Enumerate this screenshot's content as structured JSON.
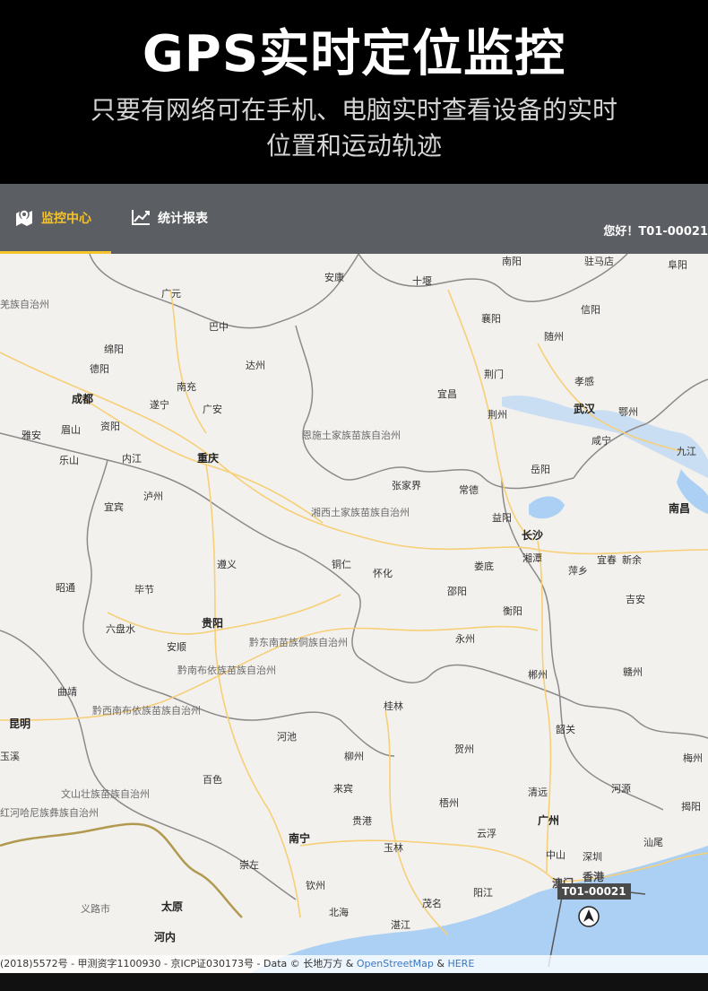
{
  "banner": {
    "headline": "GPS实时定位监控",
    "subtitle_line1": "只要有网络可在手机、电脑实时查看设备的实时",
    "subtitle_line2": "位置和运动轨迹"
  },
  "topbar": {
    "nav": [
      {
        "label": "监控中心",
        "icon": "map-pin-icon",
        "active": true
      },
      {
        "label": "统计报表",
        "icon": "line-chart-icon",
        "active": false
      }
    ],
    "greeting": "您好！T01-00021"
  },
  "colors": {
    "banner_bg": "#000000",
    "topbar_bg": "#5b5e62",
    "active_accent": "#f5c32c",
    "map_land": "#f3f1ee",
    "map_water": "#abd0f3",
    "road": "#f6cf77"
  },
  "map": {
    "cities": [
      "南阳",
      "驻马店",
      "阜阳",
      "安康",
      "十堰",
      "广元",
      "羌族自治州",
      "信阳",
      "巴中",
      "襄阳",
      "绵阳",
      "随州",
      "德阳",
      "达州",
      "荆门",
      "孝感",
      "南充",
      "成都",
      "宜昌",
      "遂宁",
      "广安",
      "武汉",
      "荆州",
      "鄂州",
      "资阳",
      "雅安",
      "眉山",
      "恩施土家族苗族自治州",
      "咸宁",
      "内江",
      "乐山",
      "九江",
      "重庆",
      "岳阳",
      "张家界",
      "常德",
      "泸州",
      "宜宾",
      "南昌",
      "湘西土家族苗族自治州",
      "益阳",
      "长沙",
      "遵义",
      "湘潭",
      "宜春",
      "新余",
      "铜仁",
      "怀化",
      "娄底",
      "萍乡",
      "昭通",
      "毕节",
      "邵阳",
      "吉安",
      "衡阳",
      "六盘水",
      "贵阳",
      "安顺",
      "黔东南苗族侗族自治州",
      "永州",
      "黔南布依族苗族自治州",
      "郴州",
      "赣州",
      "曲靖",
      "黔西南布依族苗族自治州",
      "桂林",
      "昆明",
      "韶关",
      "河池",
      "柳州",
      "梅州",
      "玉溪",
      "贺州",
      "百色",
      "来宾",
      "河源",
      "清远",
      "文山壮族苗族自治州",
      "梧州",
      "广州",
      "揭阳",
      "红河哈尼族彝族自治州",
      "南宁",
      "贵港",
      "玉林",
      "云浮",
      "中山",
      "深圳",
      "汕尾",
      "崇左",
      "香港",
      "钦州",
      "阳江",
      "澳门",
      "义路市",
      "太原",
      "北海",
      "茂名",
      "湛江",
      "河内"
    ],
    "attribution_prefix": "(2018)5572号 - 甲测资字1100930 - 京ICP证030173号 - Data © 长地万方 &",
    "attribution_osm": "OpenStreetMap",
    "attribution_suffix": "&",
    "attribution_here": "HERE"
  },
  "vehicle": {
    "id": "T01-00021",
    "icon": "navigation-arrow-icon"
  }
}
